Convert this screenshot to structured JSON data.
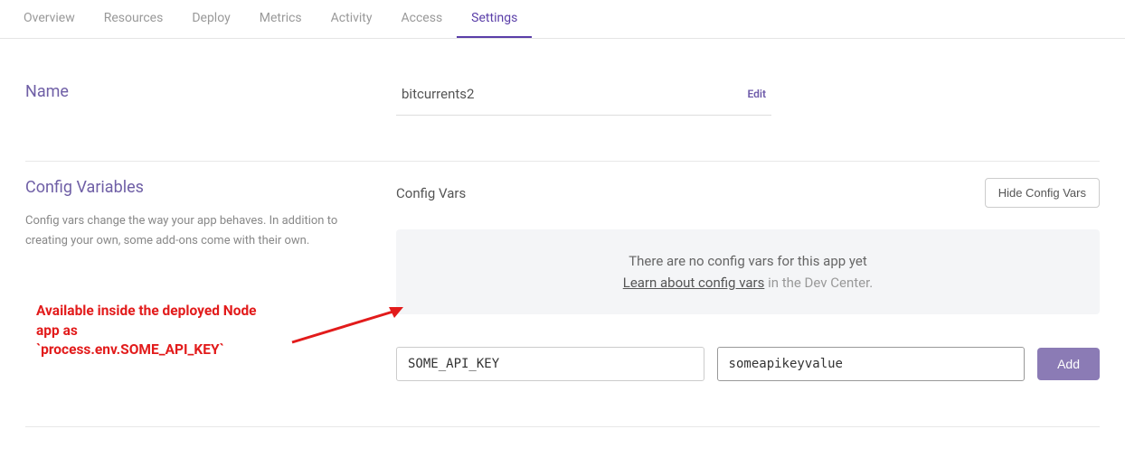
{
  "tabs": [
    {
      "label": "Overview"
    },
    {
      "label": "Resources"
    },
    {
      "label": "Deploy"
    },
    {
      "label": "Metrics"
    },
    {
      "label": "Activity"
    },
    {
      "label": "Access"
    },
    {
      "label": "Settings"
    }
  ],
  "active_tab": "Settings",
  "name_section": {
    "title": "Name",
    "value": "bitcurrents2",
    "edit_label": "Edit"
  },
  "config_section": {
    "title": "Config Variables",
    "description": "Config vars change the way your app behaves. In addition to creating your own, some add-ons come with their own.",
    "right_label": "Config Vars",
    "hide_button": "Hide Config Vars",
    "empty_message": "There are no config vars for this app yet",
    "learn_link": "Learn about config vars",
    "learn_suffix": " in the Dev Center.",
    "key_input": "SOME_API_KEY",
    "value_input": "someapikeyvalue",
    "add_button": "Add"
  },
  "annotation": {
    "line1": "Available inside the deployed Node app as",
    "line2": "`process.env.SOME_API_KEY`"
  }
}
